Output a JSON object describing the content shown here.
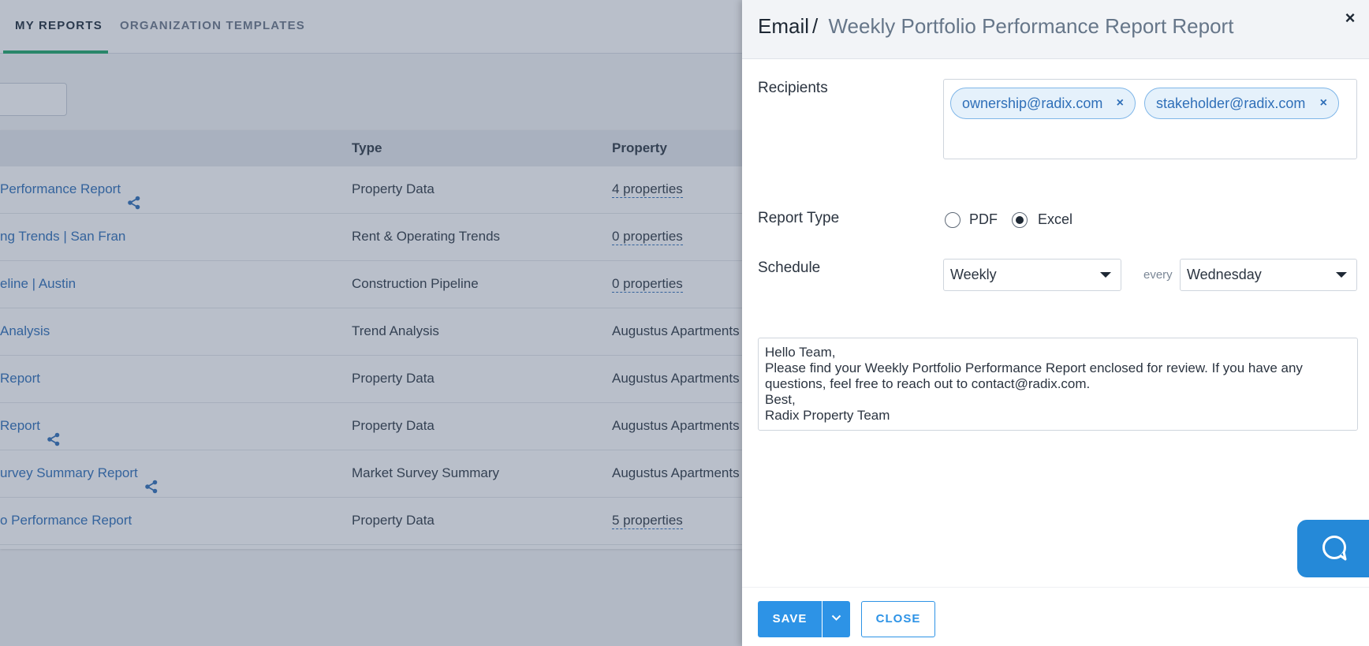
{
  "tabs": [
    {
      "label": "MY REPORTS",
      "active": true
    },
    {
      "label": "ORGANIZATION TEMPLATES",
      "active": false
    }
  ],
  "table": {
    "headers": {
      "type": "Type",
      "property": "Property"
    },
    "rows": [
      {
        "name": " Performance Report",
        "shared": true,
        "type": "Property Data",
        "property": "4 properties",
        "property_link": true
      },
      {
        "name": "ng Trends | San Fran",
        "shared": false,
        "type": "Rent & Operating Trends",
        "property": "0 properties",
        "property_link": true
      },
      {
        "name": "eline | Austin",
        "shared": false,
        "type": "Construction Pipeline",
        "property": "0 properties",
        "property_link": true
      },
      {
        "name": "Analysis",
        "shared": false,
        "type": "Trend Analysis",
        "property": "Augustus Apartments",
        "property_link": false
      },
      {
        "name": " Report",
        "shared": false,
        "type": "Property Data",
        "property": "Augustus Apartments",
        "property_link": false
      },
      {
        "name": " Report",
        "shared": true,
        "type": "Property Data",
        "property": "Augustus Apartments",
        "property_link": false
      },
      {
        "name": "urvey Summary Report",
        "shared": true,
        "type": "Market Survey Summary",
        "property": "Augustus Apartments",
        "property_link": false
      },
      {
        "name": "o Performance Report",
        "shared": false,
        "type": "Property Data",
        "property": "5 properties",
        "property_link": true
      }
    ]
  },
  "drawer": {
    "title": "Email",
    "separator": "/",
    "subtitle": "Weekly Portfolio Performance Report Report",
    "close_icon": "×",
    "recipients_label": "Recipients",
    "recipients": [
      "ownership@radix.com",
      "stakeholder@radix.com"
    ],
    "chip_remove": "×",
    "report_type_label": "Report Type",
    "report_types": [
      {
        "label": "PDF",
        "checked": false
      },
      {
        "label": "Excel",
        "checked": true
      }
    ],
    "schedule_label": "Schedule",
    "frequency": "Weekly",
    "every_label": "every",
    "day": "Wednesday",
    "message": "Hello Team,\nPlease find your Weekly Portfolio Performance Report enclosed for review. If you have any questions, feel free to reach out to contact@radix.com.\nBest,\nRadix Property Team",
    "save_label": "SAVE",
    "close_label": "CLOSE"
  },
  "colors": {
    "accent": "#2d93e6",
    "link": "#2f6fb8",
    "active_tab": "#1fa66a",
    "help_button": "#2589d8"
  }
}
